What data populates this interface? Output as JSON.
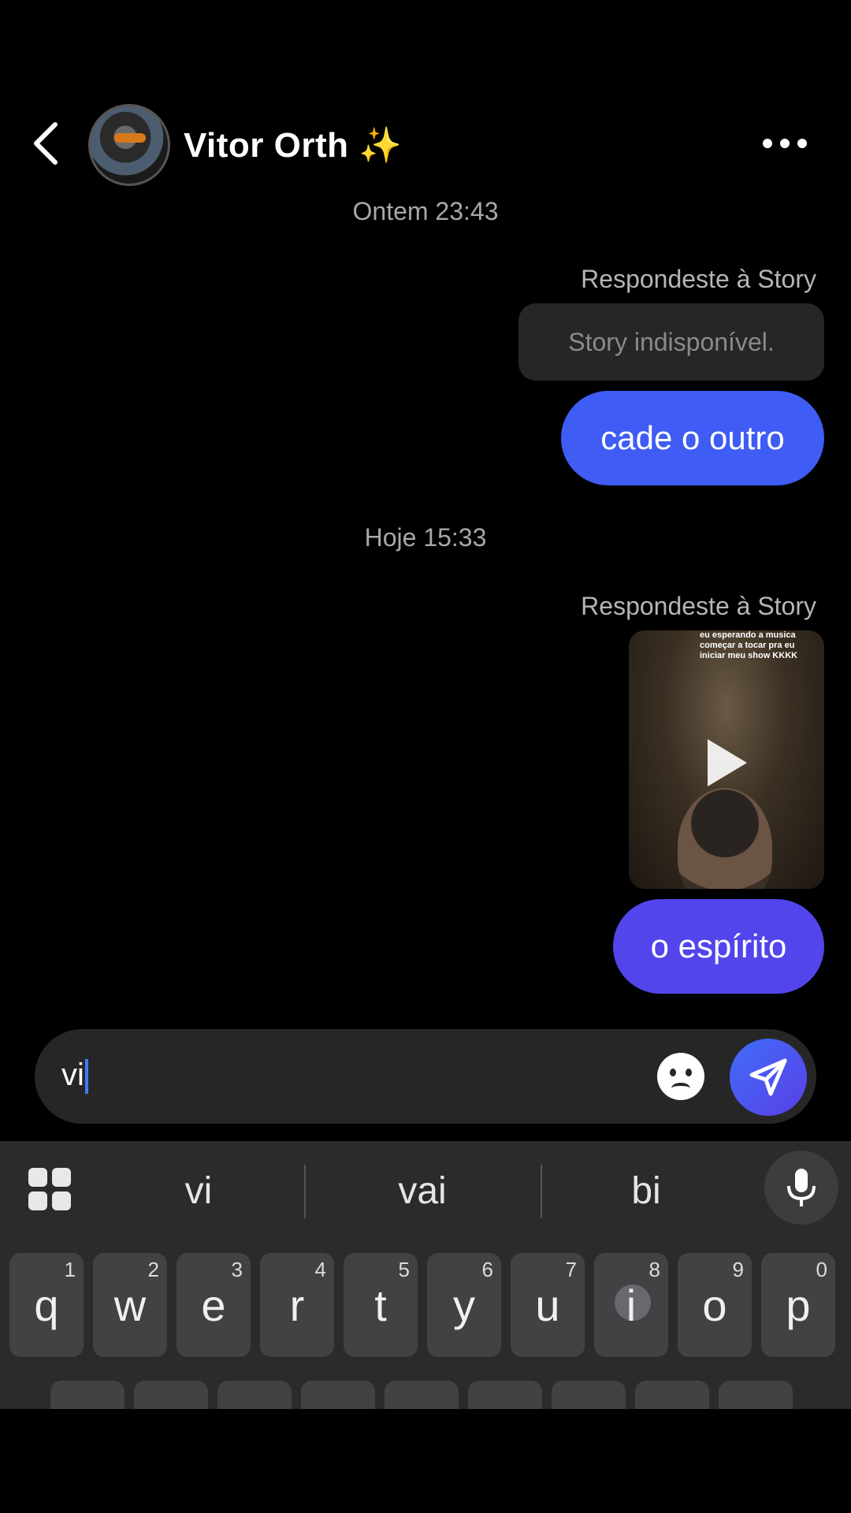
{
  "header": {
    "name": "Vitor Orth ✨",
    "back_icon": "chevron-left-icon",
    "more_icon": "more-dots-icon"
  },
  "messages": {
    "timestamp_1": "Ontem 23:43",
    "reply_label_1": "Respondeste à Story",
    "story_unavailable": "Story indisponível.",
    "bubble_1": "cade o outro",
    "timestamp_2": "Hoje 15:33",
    "reply_label_2": "Respondeste à Story",
    "story_caption": "eu esperando a musica começar a tocar pra eu iniciar meu show KKKK",
    "bubble_2": "o espírito"
  },
  "composer": {
    "value": "vi",
    "sticker_icon": "sticker-icon",
    "send_icon": "send-icon"
  },
  "keyboard": {
    "suggestions": [
      "vi",
      "vai",
      "bi"
    ],
    "row1": [
      {
        "ch": "q",
        "num": "1"
      },
      {
        "ch": "w",
        "num": "2"
      },
      {
        "ch": "e",
        "num": "3"
      },
      {
        "ch": "r",
        "num": "4"
      },
      {
        "ch": "t",
        "num": "5"
      },
      {
        "ch": "y",
        "num": "6"
      },
      {
        "ch": "u",
        "num": "7"
      },
      {
        "ch": "i",
        "num": "8"
      },
      {
        "ch": "o",
        "num": "9"
      },
      {
        "ch": "p",
        "num": "0"
      }
    ],
    "colors": {
      "bubble_sent_1": "#3f5cf5",
      "bubble_sent_2": "#5245ec",
      "accent": "#3f7cff"
    }
  }
}
